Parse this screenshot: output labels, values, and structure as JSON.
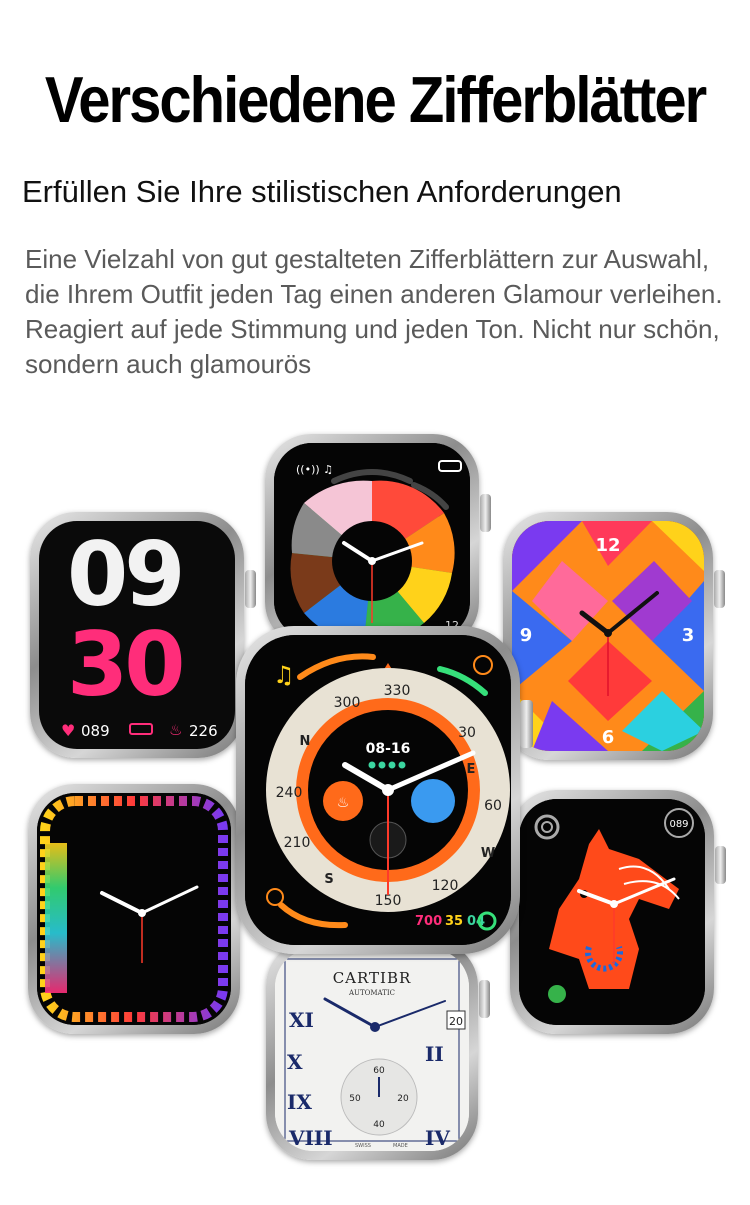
{
  "header": {
    "title": "Verschiedene Zifferblätter",
    "subtitle": "Erfüllen Sie Ihre stilistischen Anforderungen",
    "description": "Eine Vielzahl von gut gestalteten Zifferblättern zur Auswahl, die Ihrem Outfit jeden Tag einen anderen Glamour verleihen. Reagiert auf jede Stimmung und jeden Ton. Nicht nur schön, sondern auch glamourös"
  },
  "watches": {
    "digital": {
      "hour": "09",
      "minute": "30",
      "heart": "089",
      "steps": "226"
    },
    "swirl": {
      "numeral": "12"
    },
    "colorful": {
      "n12": "12",
      "n3": "3",
      "n6": "6",
      "n9": "9"
    },
    "compass": {
      "date": "08-16",
      "bezel": [
        "330",
        "300",
        "240",
        "210",
        "150",
        "120",
        "60",
        "30"
      ],
      "letters": [
        "N",
        "E",
        "S",
        "W"
      ],
      "stats": {
        "move": "700",
        "exercise": "35",
        "stand": "04"
      }
    },
    "horse": {
      "badge": "089"
    },
    "cartier": {
      "brand": "CARTIBR",
      "subtext": "AUTOMATIC",
      "date": "20",
      "sub60": "60",
      "sub20": "20",
      "sub40": "40",
      "sub50": "50",
      "swiss": "SWISS",
      "made": "MADE"
    }
  },
  "colors": {
    "accent_orange": "#ff6a1a",
    "heart_pink": "#ff2d7a",
    "ring_teal": "#3bd6a0"
  }
}
